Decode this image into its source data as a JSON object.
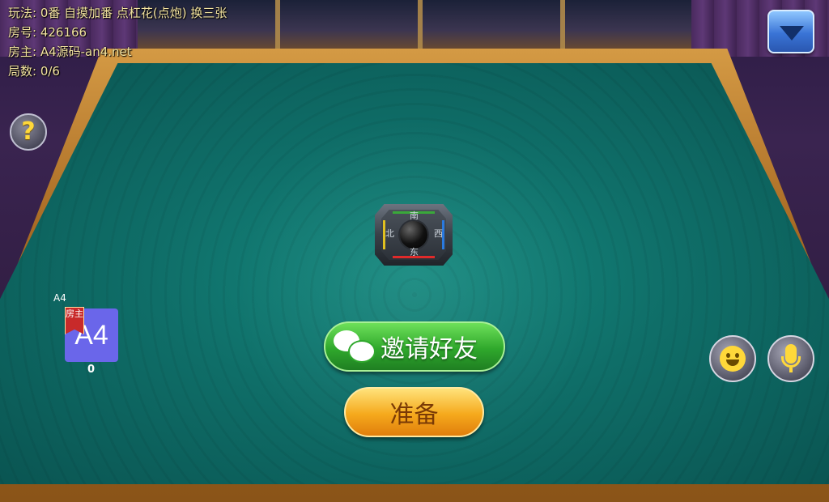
{
  "info": {
    "rules": "玩法: 0番 自摸加番 点杠花(点炮) 换三张",
    "room": "房号: 426166",
    "host": "房主: A4源码-an4.net",
    "rounds": "局数: 0/6"
  },
  "help": {
    "glyph": "?"
  },
  "compass": {
    "north": "南",
    "south": "东",
    "west": "北",
    "east": "西"
  },
  "player": {
    "name": "A4",
    "avatar_text": "A4",
    "host_tag": "房主",
    "score": "0"
  },
  "buttons": {
    "invite": "邀请好友",
    "ready": "准备"
  },
  "icons": {
    "menu": "chevron-down-icon",
    "help": "question-icon",
    "invite": "wechat-icon",
    "emoji": "smiley-icon",
    "voice": "microphone-icon"
  },
  "colors": {
    "felt": "#0f6e68",
    "invite": "#2fa82c",
    "ready": "#f5a91c",
    "avatar": "#6a66ea"
  }
}
